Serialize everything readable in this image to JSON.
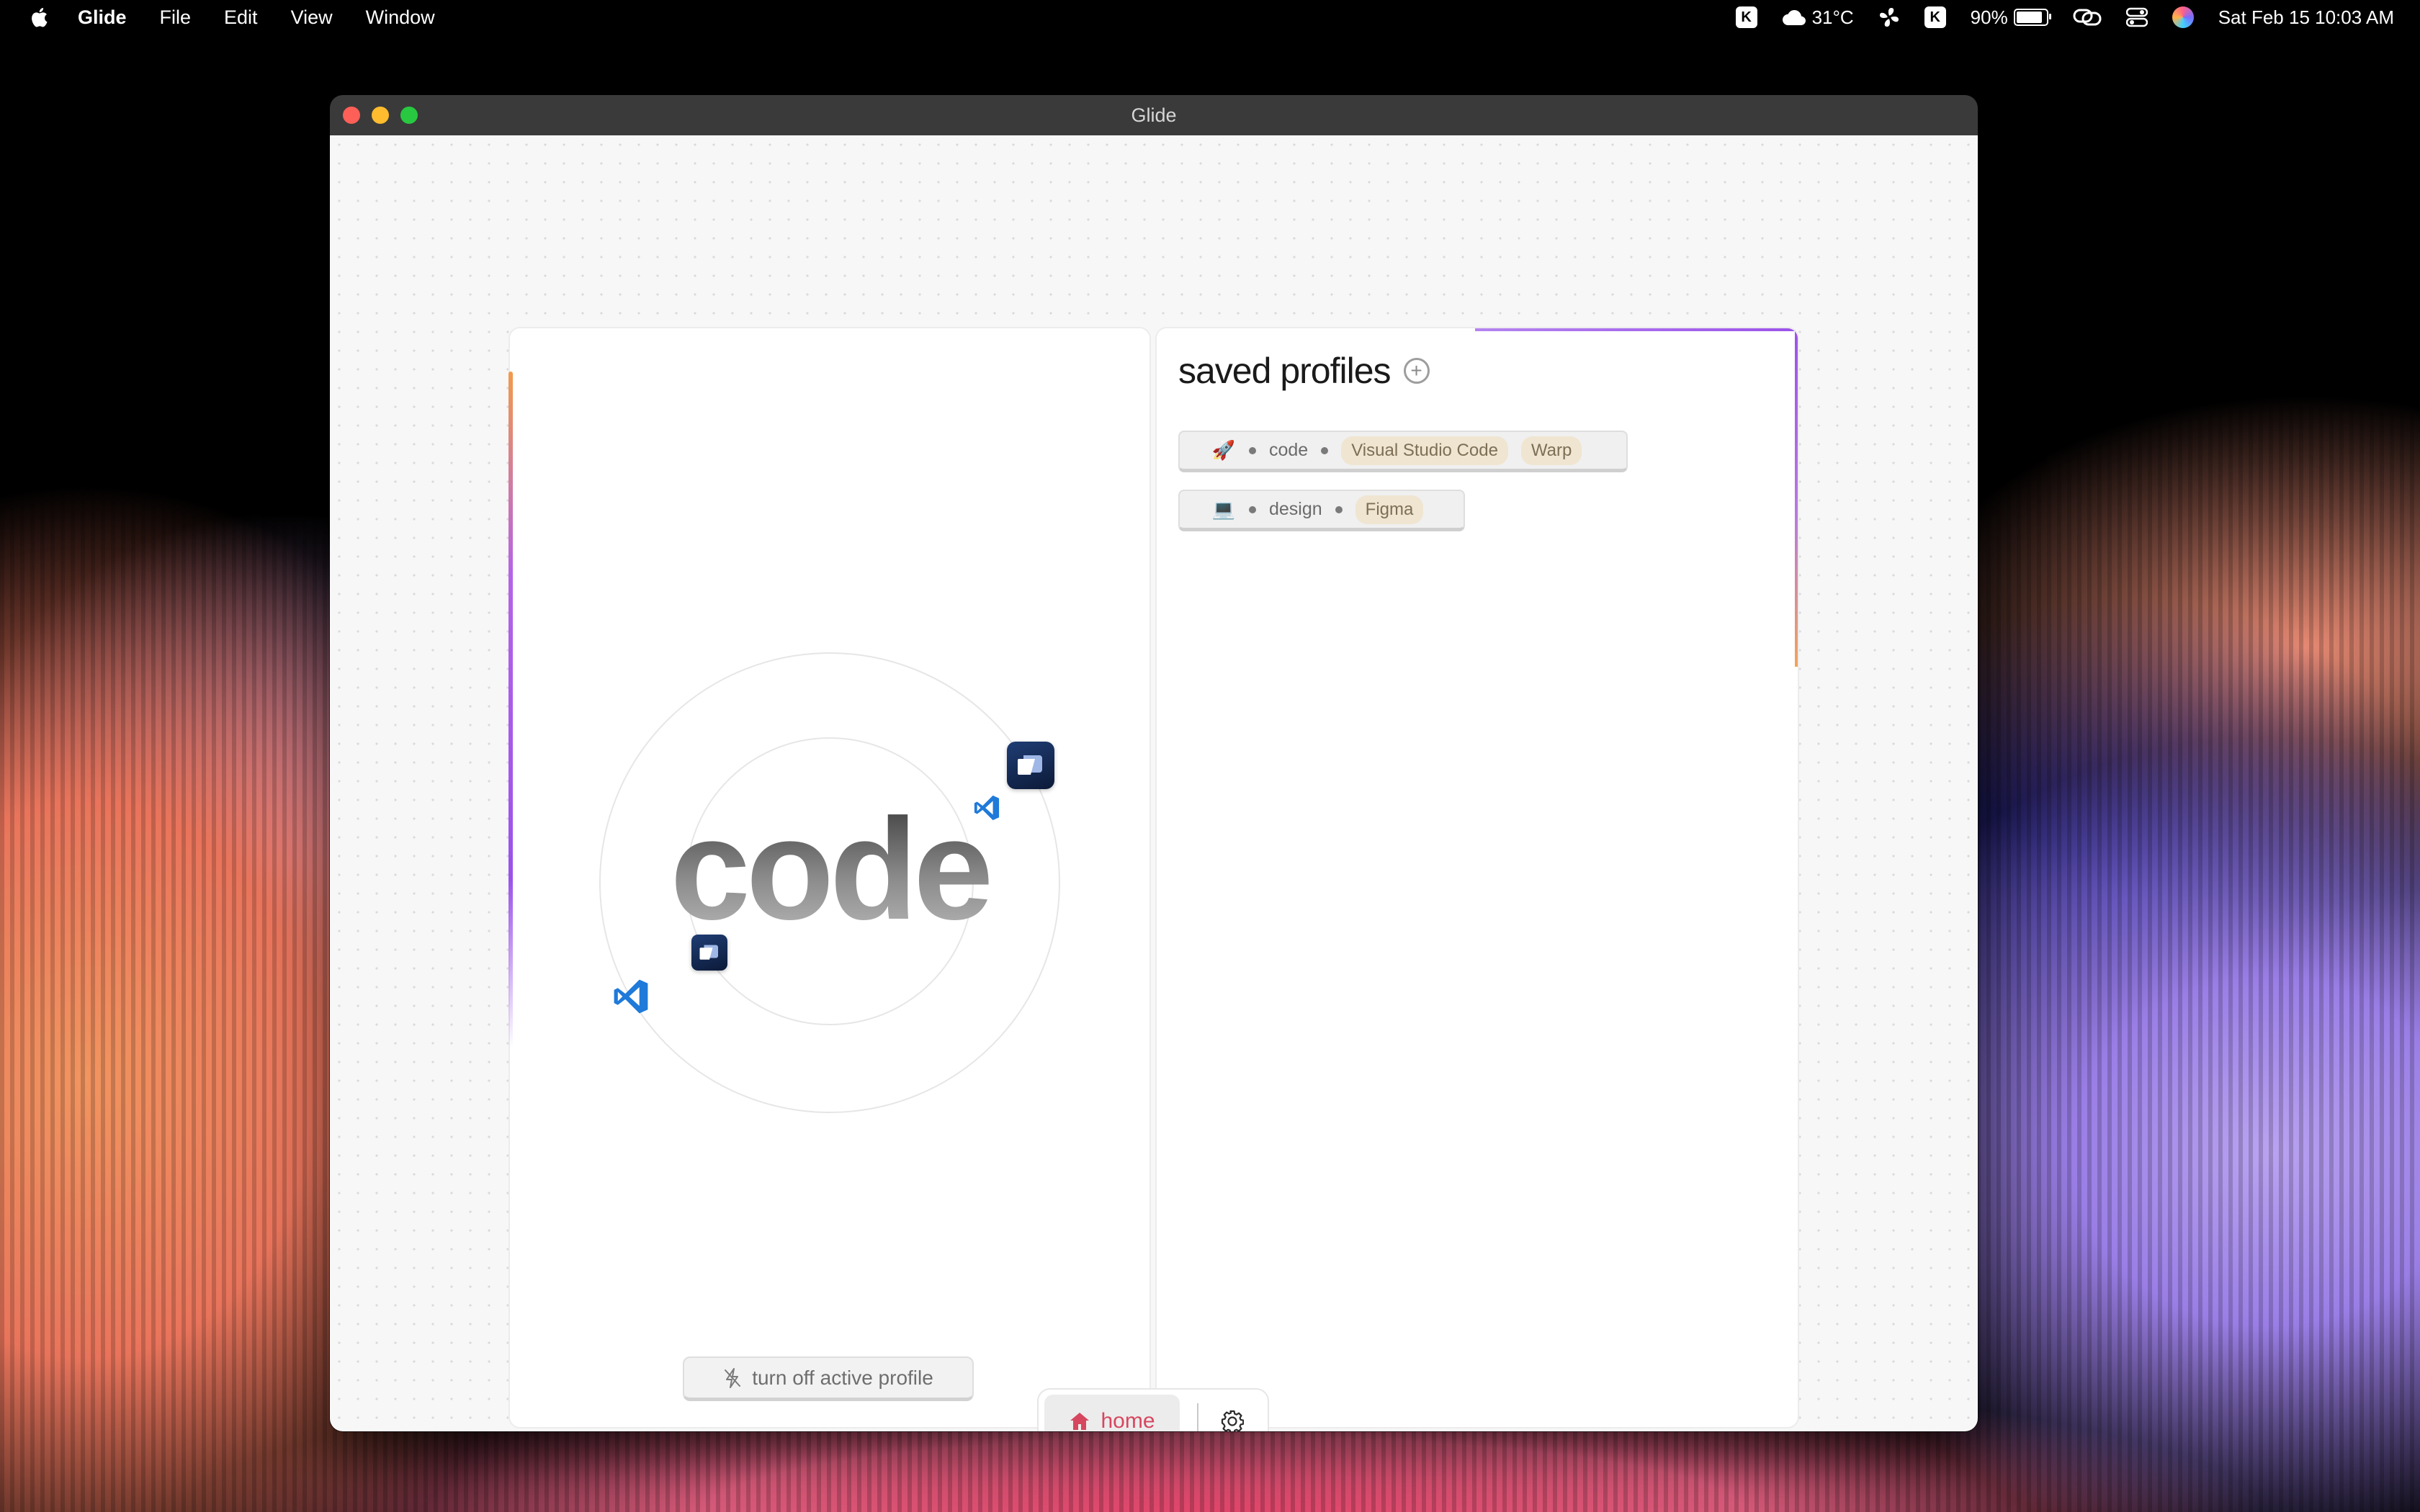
{
  "menubar": {
    "app_name": "Glide",
    "menus": [
      "File",
      "Edit",
      "View",
      "Window"
    ],
    "k_label": "K",
    "weather_temp": "31°C",
    "battery_percent": "90%",
    "battery_level": 0.9,
    "datetime": "Sat Feb 15  10:03 AM"
  },
  "window": {
    "title": "Glide"
  },
  "active_profile": {
    "name": "code",
    "apps": [
      "Visual Studio Code",
      "Warp"
    ],
    "turn_off_label": "turn off active profile"
  },
  "saved_profiles": {
    "title": "saved profiles",
    "profiles": [
      {
        "emoji": "🚀",
        "name": "code",
        "apps": [
          "Visual Studio Code",
          "Warp"
        ]
      },
      {
        "emoji": "💻",
        "name": "design",
        "apps": [
          "Figma"
        ]
      }
    ]
  },
  "nav": {
    "home_label": "home",
    "accent_color": "#d7465f"
  },
  "colors": {
    "accent_purple": "#9b52ea",
    "accent_orange": "#f29a4a"
  }
}
